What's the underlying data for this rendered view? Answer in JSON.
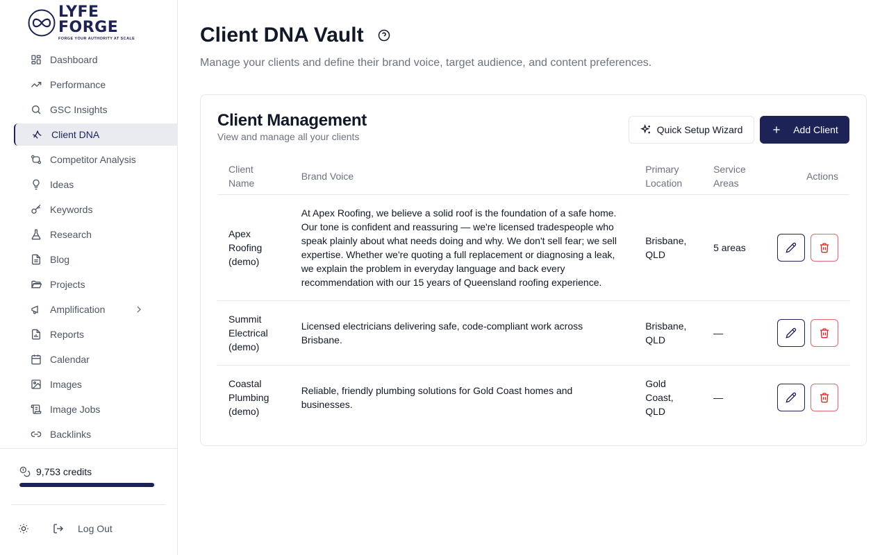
{
  "brand": {
    "name": "LYFE FORGE",
    "tagline": "FORGE YOUR AUTHORITY AT SCALE",
    "color": "#1e2357"
  },
  "sidebar": {
    "items": [
      {
        "label": "Dashboard",
        "icon": "dashboard-icon"
      },
      {
        "label": "Performance",
        "icon": "trending-up-icon"
      },
      {
        "label": "GSC Insights",
        "icon": "search-icon"
      },
      {
        "label": "Client DNA",
        "icon": "sparkle-icon",
        "active": true
      },
      {
        "label": "Competitor Analysis",
        "icon": "git-compare-icon"
      },
      {
        "label": "Ideas",
        "icon": "lightbulb-icon"
      },
      {
        "label": "Keywords",
        "icon": "key-icon"
      },
      {
        "label": "Research",
        "icon": "flask-icon"
      },
      {
        "label": "Blog",
        "icon": "file-text-icon"
      },
      {
        "label": "Projects",
        "icon": "folder-icon"
      },
      {
        "label": "Amplification",
        "icon": "megaphone-icon"
      },
      {
        "label": "Reports",
        "icon": "report-icon"
      },
      {
        "label": "Calendar",
        "icon": "calendar-icon"
      },
      {
        "label": "Images",
        "icon": "image-icon"
      },
      {
        "label": "Image Jobs",
        "icon": "scroll-icon"
      },
      {
        "label": "Backlinks",
        "icon": "link-icon"
      }
    ],
    "credits": {
      "label": "9,753 credits",
      "fraction": 0.99
    },
    "logout_label": "Log Out"
  },
  "header": {
    "title": "Client DNA Vault",
    "subtitle": "Manage your clients and define their brand voice, target audience, and content preferences."
  },
  "card": {
    "title": "Client Management",
    "subtitle": "View and manage all your clients",
    "wizard_label": "Quick Setup Wizard",
    "add_label": "Add Client"
  },
  "table": {
    "columns": {
      "name": "Client Name",
      "voice": "Brand Voice",
      "location": "Primary Location",
      "areas": "Service Areas",
      "actions": "Actions"
    },
    "rows": [
      {
        "name": "Apex Roofing (demo)",
        "voice": "At Apex Roofing, we believe a solid roof is the foundation of a safe home. Our tone is confident and reassuring — we're licensed tradespeople who speak plainly about what needs doing and why. We don't sell fear; we sell expertise. Whether we're quoting a full replacement or diagnosing a leak, we explain the problem in everyday language and back every recommendation with our 15 years of Queensland roofing experience.",
        "location": "Brisbane, QLD",
        "areas": "5 areas"
      },
      {
        "name": "Summit Electrical (demo)",
        "voice": "Licensed electricians delivering safe, code-compliant work across Brisbane.",
        "location": "Brisbane, QLD",
        "areas": "—"
      },
      {
        "name": "Coastal Plumbing (demo)",
        "voice": "Reliable, friendly plumbing solutions for Gold Coast homes and businesses.",
        "location": "Gold Coast, QLD",
        "areas": "—"
      }
    ]
  },
  "colors": {
    "accent": "#1e2357",
    "danger": "#dc2626",
    "muted": "#6b7280",
    "border": "#e5e7eb"
  }
}
